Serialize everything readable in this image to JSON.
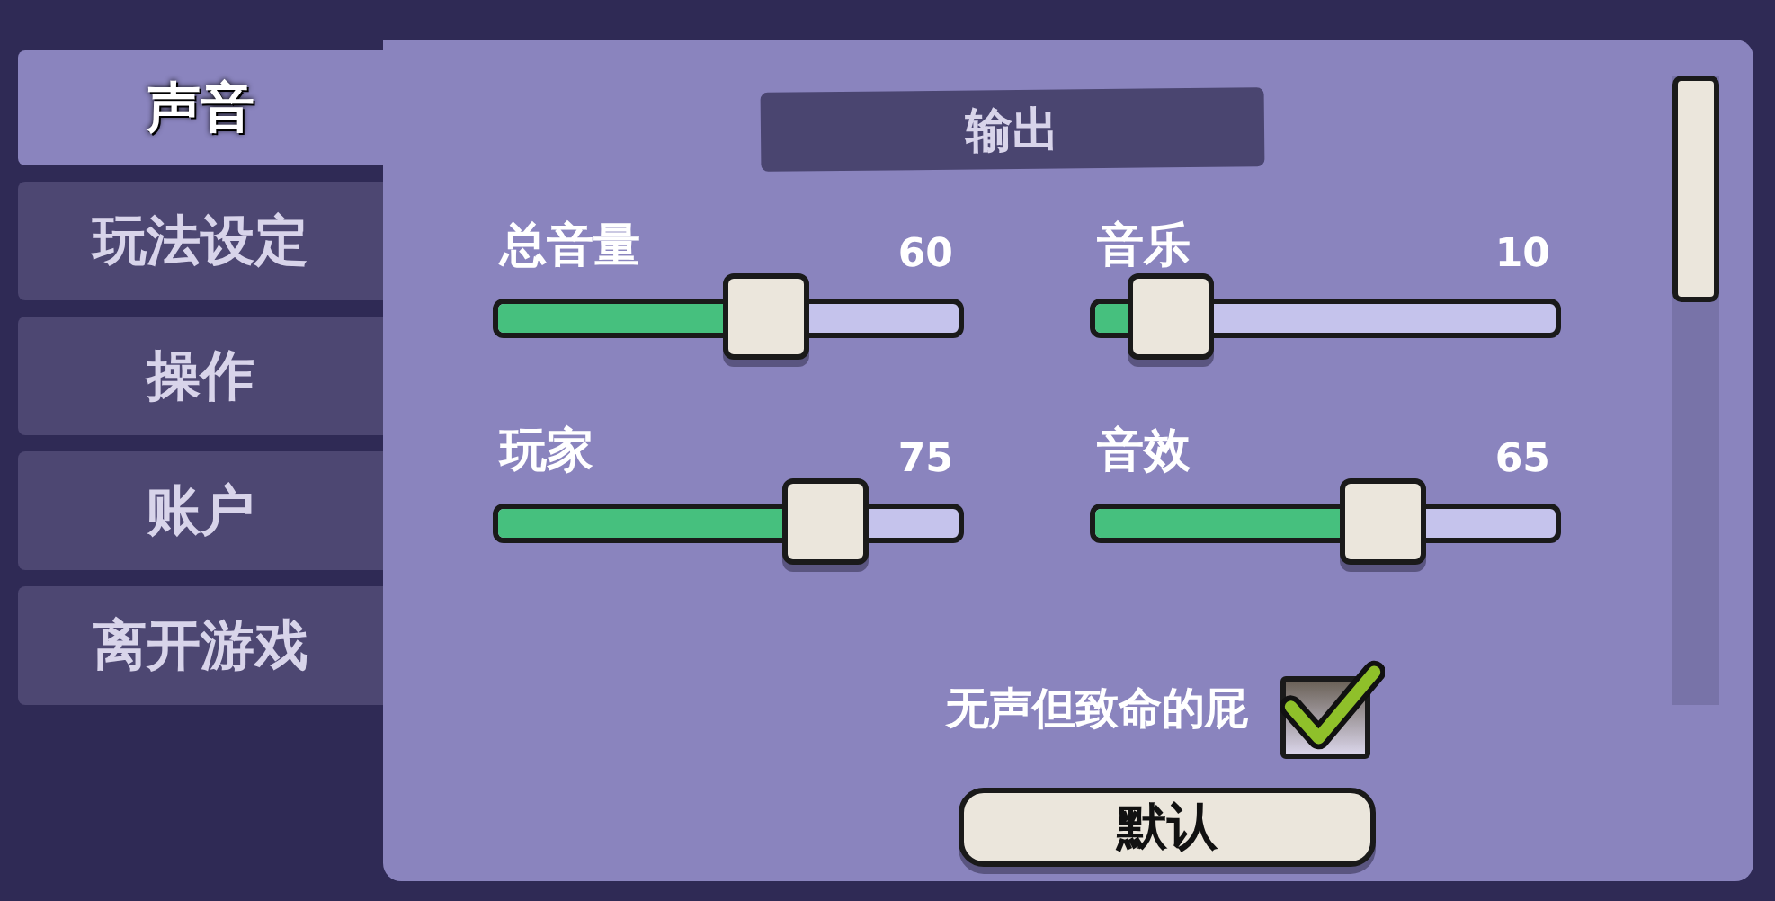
{
  "tabs": [
    {
      "label": "声音",
      "selected": true
    },
    {
      "label": "玩法设定",
      "selected": false
    },
    {
      "label": "操作",
      "selected": false
    },
    {
      "label": "账户",
      "selected": false
    },
    {
      "label": "离开游戏",
      "selected": false
    }
  ],
  "section_title": "输出",
  "sliders": [
    {
      "label": "总音量",
      "reading": "60",
      "level": 0.6
    },
    {
      "label": "音乐",
      "reading": "10",
      "level": 0.1
    },
    {
      "label": "玩家",
      "reading": "75",
      "level": 0.75
    },
    {
      "label": "音效",
      "reading": "65",
      "level": 0.65
    }
  ],
  "toggle": {
    "label": "无声但致命的屁",
    "checked": true
  },
  "button": "默认"
}
